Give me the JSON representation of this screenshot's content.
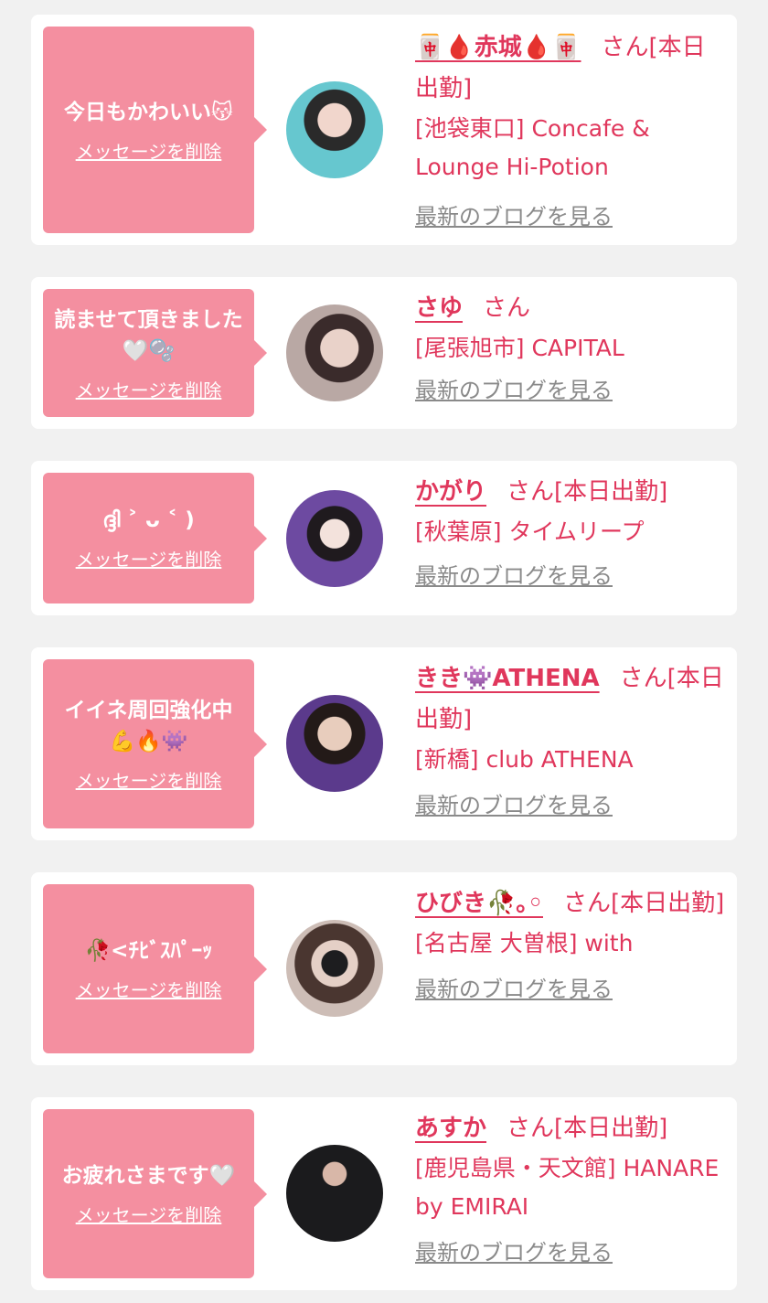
{
  "suffix": "さん",
  "cards": [
    {
      "message": "今日もかわいい😽",
      "delete_label": "メッセージを削除",
      "name": "🀄🩸赤城🩸🀄",
      "status": "[本日出勤]",
      "shop": "[池袋東口] Concafe & Lounge Hi-Potion",
      "blog_label": "最新のブログを見る"
    },
    {
      "message": "読ませて頂きました🤍🫧",
      "delete_label": "メッセージを削除",
      "name": "さゆ",
      "status": "",
      "shop": "[尾張旭市] CAPITAL",
      "blog_label": "最新のブログを見る"
    },
    {
      "message": "ദ്ദി ˃ ᴗ ˂ )",
      "delete_label": "メッセージを削除",
      "name": "かがり",
      "status": "[本日出勤]",
      "shop": "[秋葉原] タイムリープ",
      "blog_label": "最新のブログを見る"
    },
    {
      "message": "イイネ周回強化中💪🔥👾",
      "delete_label": "メッセージを削除",
      "name": "きき👾ATHENA",
      "status": "[本日出勤]",
      "shop": "[新橋] club ATHENA",
      "blog_label": "最新のブログを見る"
    },
    {
      "message": "🥀<ﾁﾋﾞｽﾊﾟｰｯ",
      "delete_label": "メッセージを削除",
      "name": "ひびき🥀｡◦",
      "status": "[本日出勤]",
      "shop": "[名古屋 大曽根] with",
      "blog_label": "最新のブログを見る"
    },
    {
      "message": "お疲れさまです🤍",
      "delete_label": "メッセージを削除",
      "name": "あすか",
      "status": "[本日出勤]",
      "shop": "[鹿児島県・天文館] HANARE by EMIRAI",
      "blog_label": "最新のブログを見る"
    }
  ]
}
